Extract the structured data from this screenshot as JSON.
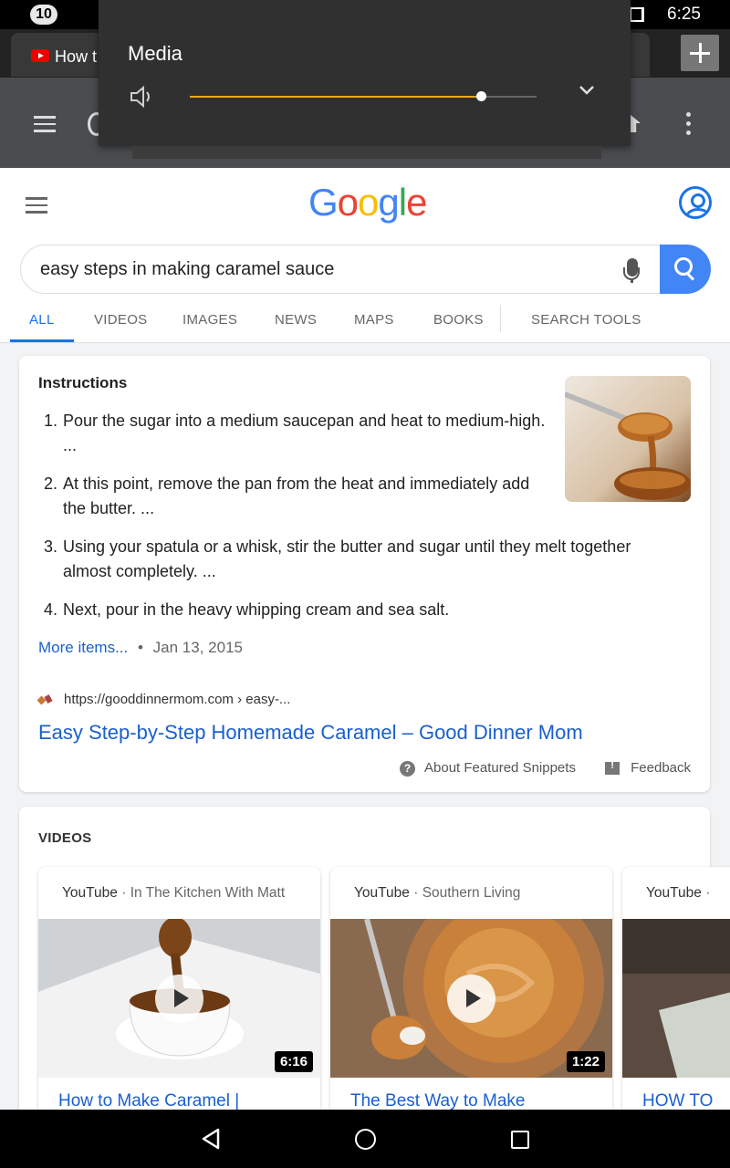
{
  "status_bar": {
    "notification_count": "10",
    "time": "6:25"
  },
  "browser": {
    "tab_title": "How t",
    "new_tab_icon": "plus-icon"
  },
  "media_popup": {
    "title": "Media",
    "volume_level": 0.84,
    "accent_color": "#f5a623"
  },
  "google": {
    "logo": [
      "G",
      "o",
      "o",
      "g",
      "l",
      "e"
    ],
    "logo_colors": [
      "#4285f4",
      "#ea4335",
      "#fbbc05",
      "#4285f4",
      "#34a853",
      "#ea4335"
    ],
    "search_query": "easy steps in making caramel sauce",
    "tabs": [
      {
        "label": "ALL"
      },
      {
        "label": "VIDEOS"
      },
      {
        "label": "IMAGES"
      },
      {
        "label": "NEWS"
      },
      {
        "label": "MAPS"
      },
      {
        "label": "BOOKS"
      },
      {
        "label": "SEARCH TOOLS"
      }
    ]
  },
  "snippet": {
    "heading": "Instructions",
    "steps": [
      {
        "num": "1.",
        "text": "Pour the sugar into a medium saucepan and heat to medium-high. ..."
      },
      {
        "num": "2.",
        "text": "At this point, remove the pan from the heat and immediately add the butter. ..."
      },
      {
        "num": "3.",
        "text": "Using your spatula or a whisk, stir the butter and sugar until they melt together almost completely. ..."
      },
      {
        "num": "4.",
        "text": "Next, pour in the heavy whipping cream and sea salt."
      }
    ],
    "more_items": "More items...",
    "separator": "•",
    "date": "Jan 13, 2015",
    "source_url": "https://gooddinnermom.com › easy-...",
    "result_title": "Easy Step-by-Step Homemade Caramel – Good Dinner Mom",
    "about_label": "About Featured Snippets",
    "feedback_label": "Feedback"
  },
  "videos": {
    "heading": "VIDEOS",
    "items": [
      {
        "source": "YouTube",
        "channel": " · In The Kitchen With Matt",
        "duration": "6:16",
        "title": "How to Make Caramel |"
      },
      {
        "source": "YouTube",
        "channel": " · Southern Living",
        "duration": "1:22",
        "title": "The Best Way to Make"
      },
      {
        "source": "YouTube",
        "channel": " ·",
        "duration": "",
        "title": "HOW TO"
      }
    ]
  }
}
